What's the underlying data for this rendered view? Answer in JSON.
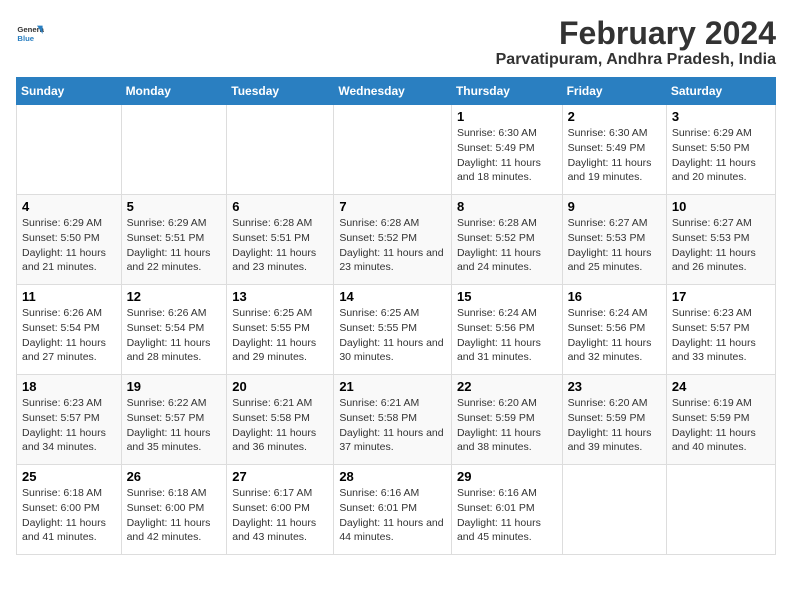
{
  "header": {
    "logo_line1": "General",
    "logo_line2": "Blue",
    "month_title": "February 2024",
    "location": "Parvatipuram, Andhra Pradesh, India"
  },
  "days_of_week": [
    "Sunday",
    "Monday",
    "Tuesday",
    "Wednesday",
    "Thursday",
    "Friday",
    "Saturday"
  ],
  "weeks": [
    [
      {
        "day": "",
        "info": ""
      },
      {
        "day": "",
        "info": ""
      },
      {
        "day": "",
        "info": ""
      },
      {
        "day": "",
        "info": ""
      },
      {
        "day": "1",
        "info": "Sunrise: 6:30 AM\nSunset: 5:49 PM\nDaylight: 11 hours and 18 minutes."
      },
      {
        "day": "2",
        "info": "Sunrise: 6:30 AM\nSunset: 5:49 PM\nDaylight: 11 hours and 19 minutes."
      },
      {
        "day": "3",
        "info": "Sunrise: 6:29 AM\nSunset: 5:50 PM\nDaylight: 11 hours and 20 minutes."
      }
    ],
    [
      {
        "day": "4",
        "info": "Sunrise: 6:29 AM\nSunset: 5:50 PM\nDaylight: 11 hours and 21 minutes."
      },
      {
        "day": "5",
        "info": "Sunrise: 6:29 AM\nSunset: 5:51 PM\nDaylight: 11 hours and 22 minutes."
      },
      {
        "day": "6",
        "info": "Sunrise: 6:28 AM\nSunset: 5:51 PM\nDaylight: 11 hours and 23 minutes."
      },
      {
        "day": "7",
        "info": "Sunrise: 6:28 AM\nSunset: 5:52 PM\nDaylight: 11 hours and 23 minutes."
      },
      {
        "day": "8",
        "info": "Sunrise: 6:28 AM\nSunset: 5:52 PM\nDaylight: 11 hours and 24 minutes."
      },
      {
        "day": "9",
        "info": "Sunrise: 6:27 AM\nSunset: 5:53 PM\nDaylight: 11 hours and 25 minutes."
      },
      {
        "day": "10",
        "info": "Sunrise: 6:27 AM\nSunset: 5:53 PM\nDaylight: 11 hours and 26 minutes."
      }
    ],
    [
      {
        "day": "11",
        "info": "Sunrise: 6:26 AM\nSunset: 5:54 PM\nDaylight: 11 hours and 27 minutes."
      },
      {
        "day": "12",
        "info": "Sunrise: 6:26 AM\nSunset: 5:54 PM\nDaylight: 11 hours and 28 minutes."
      },
      {
        "day": "13",
        "info": "Sunrise: 6:25 AM\nSunset: 5:55 PM\nDaylight: 11 hours and 29 minutes."
      },
      {
        "day": "14",
        "info": "Sunrise: 6:25 AM\nSunset: 5:55 PM\nDaylight: 11 hours and 30 minutes."
      },
      {
        "day": "15",
        "info": "Sunrise: 6:24 AM\nSunset: 5:56 PM\nDaylight: 11 hours and 31 minutes."
      },
      {
        "day": "16",
        "info": "Sunrise: 6:24 AM\nSunset: 5:56 PM\nDaylight: 11 hours and 32 minutes."
      },
      {
        "day": "17",
        "info": "Sunrise: 6:23 AM\nSunset: 5:57 PM\nDaylight: 11 hours and 33 minutes."
      }
    ],
    [
      {
        "day": "18",
        "info": "Sunrise: 6:23 AM\nSunset: 5:57 PM\nDaylight: 11 hours and 34 minutes."
      },
      {
        "day": "19",
        "info": "Sunrise: 6:22 AM\nSunset: 5:57 PM\nDaylight: 11 hours and 35 minutes."
      },
      {
        "day": "20",
        "info": "Sunrise: 6:21 AM\nSunset: 5:58 PM\nDaylight: 11 hours and 36 minutes."
      },
      {
        "day": "21",
        "info": "Sunrise: 6:21 AM\nSunset: 5:58 PM\nDaylight: 11 hours and 37 minutes."
      },
      {
        "day": "22",
        "info": "Sunrise: 6:20 AM\nSunset: 5:59 PM\nDaylight: 11 hours and 38 minutes."
      },
      {
        "day": "23",
        "info": "Sunrise: 6:20 AM\nSunset: 5:59 PM\nDaylight: 11 hours and 39 minutes."
      },
      {
        "day": "24",
        "info": "Sunrise: 6:19 AM\nSunset: 5:59 PM\nDaylight: 11 hours and 40 minutes."
      }
    ],
    [
      {
        "day": "25",
        "info": "Sunrise: 6:18 AM\nSunset: 6:00 PM\nDaylight: 11 hours and 41 minutes."
      },
      {
        "day": "26",
        "info": "Sunrise: 6:18 AM\nSunset: 6:00 PM\nDaylight: 11 hours and 42 minutes."
      },
      {
        "day": "27",
        "info": "Sunrise: 6:17 AM\nSunset: 6:00 PM\nDaylight: 11 hours and 43 minutes."
      },
      {
        "day": "28",
        "info": "Sunrise: 6:16 AM\nSunset: 6:01 PM\nDaylight: 11 hours and 44 minutes."
      },
      {
        "day": "29",
        "info": "Sunrise: 6:16 AM\nSunset: 6:01 PM\nDaylight: 11 hours and 45 minutes."
      },
      {
        "day": "",
        "info": ""
      },
      {
        "day": "",
        "info": ""
      }
    ]
  ]
}
